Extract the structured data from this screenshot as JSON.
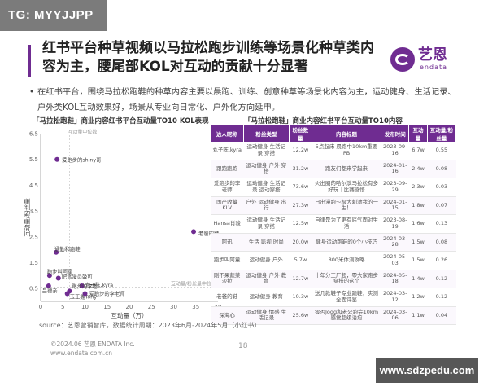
{
  "tg_badge": "TG: MYYJJPP",
  "title": "红书平台种草视频以马拉松跑步训练等场景化种草类内容为主，腰尾部KOL对互动的贡献十分显著",
  "logo": {
    "name": "艺恩",
    "sub": "endata",
    "color": "#6f2c91"
  },
  "bullet": "在红书平台，围绕马拉松跑鞋的种草内容主要以晨跑、训练、创意种草等场景化内容为主，运动健身、生活记录、户外类KOL互动效果好，场景从专业向日常化、户外化方向延申。",
  "chart_title": "「马拉松跑鞋」商业内容红书平台互动量TO10 KOL表现",
  "table_title": "「马拉松跑鞋」商业内容红书平台互动量TO10内容",
  "chart_data": {
    "type": "scatter",
    "xlabel": "互动量（万）",
    "ylabel": "互动量/粉丝量",
    "xlim": [
      0,
      40
    ],
    "ylim": [
      0,
      6.5
    ],
    "xticks": [
      0,
      5,
      10,
      15,
      20,
      25,
      30,
      35,
      40
    ],
    "yticks": [
      0.5,
      1.5,
      2.5,
      3.5,
      4.5,
      5.5,
      6.5
    ],
    "points": [
      {
        "label": "爱跑步的shiny哥",
        "x": 3.7,
        "y": 5.5
      },
      {
        "label": "老爸的鞋",
        "x": 34.5,
        "y": 2.7
      },
      {
        "label": "通勤和跑鞋",
        "x": 3.5,
        "y": 1.9
      },
      {
        "label": "跑步叫阿童",
        "x": 2.0,
        "y": 1.0
      },
      {
        "label": "肥宫漫员鼓可",
        "x": 4.0,
        "y": 0.9
      },
      {
        "label": "丸子陈,kyra",
        "x": 9.3,
        "y": 0.6
      },
      {
        "label": "跑步的李老",
        "x": 6.5,
        "y": 0.4
      },
      {
        "label": "玉王鑫Tony",
        "x": 6.0,
        "y": 0.3
      },
      {
        "label": "爱跑步的李老师",
        "x": 10.0,
        "y": 0.3
      },
      {
        "label": "吕德亲",
        "x": 1.8,
        "y": 0.6
      }
    ],
    "ref_lines": {
      "x_median_label": "互动量中位数",
      "x_median": 6.5,
      "y_median_label": "互动量/粉丝量中位数",
      "y_median": 0.55
    },
    "color": "#6f2c91"
  },
  "table": {
    "headers": [
      "达人昵称",
      "粉丝类型",
      "粉丝数量",
      "内容标题",
      "发布时间",
      "互动量",
      "互动量/粉丝量"
    ],
    "rows": [
      [
        "丸子陈,kyra",
        "运动健身 生活记录 穿搭",
        "12.2w",
        "5点起床 晨跑中10km重要PB",
        "2023-09-16",
        "6.7w",
        "0.55"
      ],
      [
        "跟跑跑跑",
        "运动健身 户外 穿搭",
        "31.2w",
        "跑友们都来学起来",
        "2024-01-16",
        "2.4w",
        "0.08"
      ],
      [
        "爱跑步的李老师",
        "运动健身 生活记录 运动穿搭",
        "73.6w",
        "火出圈的哈尔滨马拉松有多好玩｜比赛感悟",
        "2023-09-29",
        "2.3w",
        "0.03"
      ],
      [
        "国产收藏KLV",
        "户外 运动健身 出行",
        "27.3w",
        "日出漫跑～极大刺激我的一生！",
        "2024-01-15",
        "1.8w",
        "0.07"
      ],
      [
        "Hansa肖骏",
        "运动健身 生活记录 穿搭",
        "12.5w",
        "自律是为了更有底气面对生活",
        "2023-08-19",
        "1.6w",
        "0.13"
      ],
      [
        "阿迅",
        "生活 影视 时尚",
        "20.0w",
        "健身运动跑鞋的0个小技巧",
        "2024-03-28",
        "1.5w",
        "0.08"
      ],
      [
        "跑步叫阿童",
        "运动健身 户外",
        "5.7w",
        "800米体测攻略",
        "2024-05-03",
        "1.5w",
        "0.26"
      ],
      [
        "刚不果蔬菜沙拉",
        "运动健身 户外 教育",
        "12.7w",
        "十年分工厂超，零大家跑步穿搭的这个",
        "2024-05-18",
        "1.4w",
        "0.12"
      ],
      [
        "老爸的鞋",
        "运动健身 教育",
        "10.3w",
        "送几款鞋子专业跑鞋，实测全面评鉴",
        "2024-03-12",
        "1.2w",
        "0.12"
      ],
      [
        "深海心",
        "运动健身 情感 生活记录",
        "25.6w",
        "零否Jogg和老公跑完10km感觉超级治愈",
        "2024-03-06",
        "1.1w",
        "0.04"
      ]
    ]
  },
  "source": "source：艺恩营销智库，数据统计周期：2023年6月-2024年5月（小红书）",
  "copyright": "©2024.06 艺恩 ENDATA Inc.",
  "website": "www.endata.com.cn",
  "page_number": "18",
  "watermark": "www.sdzpedu.com"
}
